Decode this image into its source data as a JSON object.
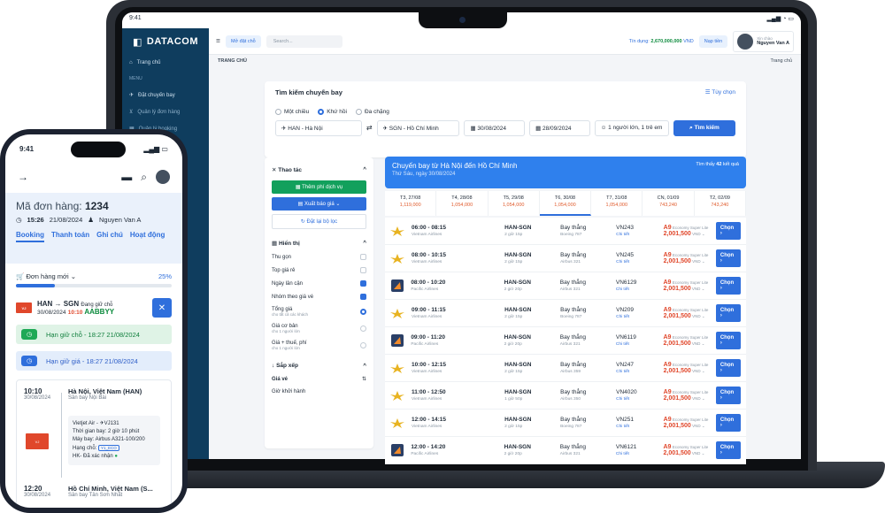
{
  "status_time": "9:41",
  "brand": "DATACOM",
  "sidebar": {
    "home": "Trang chủ",
    "menu": "MENU",
    "items": [
      "Đặt chuyến bay",
      "Quản lý đơn hàng",
      "Quản lý booking"
    ]
  },
  "header": {
    "mode_btn": "Mở đặt chỗ",
    "search_placeholder": "Search...",
    "credit_label": "Tín dụng:",
    "credit_value": "2,670,000,000",
    "credit_unit": "VND",
    "topup": "Nạp tiền",
    "greeting": "Xin chào",
    "user": "Nguyen Van A"
  },
  "breadcrumb": {
    "left": "TRANG CHỦ",
    "right": "Trang chủ"
  },
  "search": {
    "title": "Tìm kiếm chuyến bay",
    "options": "Tùy chọn",
    "trip_types": [
      "Một chiều",
      "Khứ hồi",
      "Đa chặng"
    ],
    "from": "HAN - Hà Nội",
    "to": "SGN - Hồ Chí Minh",
    "depart": "30/08/2024",
    "return": "28/09/2024",
    "pax": "1 người lớn, 1 trẻ em",
    "submit": "Tìm kiếm"
  },
  "filters": {
    "actions_title": "Thao tác",
    "add_service": "Thêm phí dịch vụ",
    "export": "Xuất báo giá",
    "reset": "Đặt lại bộ lọc",
    "display_title": "Hiển thị",
    "checks": [
      {
        "label": "Thu gọn",
        "on": false
      },
      {
        "label": "Top giá rẻ",
        "on": false
      },
      {
        "label": "Ngày lân cận",
        "on": true
      },
      {
        "label": "Nhóm theo giá vé",
        "on": true
      }
    ],
    "price_opts": [
      {
        "label": "Tổng giá",
        "sub": "cho tất cả các khách",
        "on": true
      },
      {
        "label": "Giá cơ bản",
        "sub": "cho 1 người lớn",
        "on": false
      },
      {
        "label": "Giá + thuế, phí",
        "sub": "cho 1 người lớn",
        "on": false
      }
    ],
    "sort_title": "Sắp xếp",
    "sort_items": [
      "Giá vé",
      "Giờ khởi hành"
    ]
  },
  "results": {
    "title": "Chuyến bay từ Hà Nội đến Hồ Chí Minh",
    "subtitle": "Thứ Sáu, ngày 30/08/2024",
    "count_prefix": "Tìm thấy",
    "count": "42",
    "count_suffix": "kết quả"
  },
  "dates": [
    {
      "d": "T3, 27/08",
      "p": "1,119,000"
    },
    {
      "d": "T4, 28/08",
      "p": "1,054,000"
    },
    {
      "d": "T5, 29/08",
      "p": "1,054,000"
    },
    {
      "d": "T6, 30/08",
      "p": "1,054,000"
    },
    {
      "d": "T7, 31/08",
      "p": "1,054,000"
    },
    {
      "d": "CN, 01/09",
      "p": "743,240"
    },
    {
      "d": "T2, 02/09",
      "p": "743,240"
    }
  ],
  "flights": [
    {
      "time": "06:00 - 08:15",
      "airline": "Vietnam Airlines",
      "route": "HAN-SGN",
      "dur": "2 giờ 15p",
      "type": "Bay thẳng",
      "plane": "Boeing 787",
      "code": "VN243",
      "fare": "Economy Super Lite",
      "price": "2,001,500",
      "logo": "va"
    },
    {
      "time": "08:00 - 10:15",
      "airline": "Vietnam Airlines",
      "route": "HAN-SGN",
      "dur": "2 giờ 15p",
      "type": "Bay thẳng",
      "plane": "Airbus 321",
      "code": "VN245",
      "fare": "Economy Super Lite",
      "price": "2,001,500",
      "logo": "va"
    },
    {
      "time": "08:00 - 10:20",
      "airline": "Pacific Airlines",
      "route": "HAN-SGN",
      "dur": "2 giờ 20p",
      "type": "Bay thẳng",
      "plane": "Airbus 321",
      "code": "VN6129",
      "fare": "Economy Super Lite",
      "price": "2,001,500",
      "logo": "pa"
    },
    {
      "time": "09:00 - 11:15",
      "airline": "Vietnam Airlines",
      "route": "HAN-SGN",
      "dur": "2 giờ 15p",
      "type": "Bay thẳng",
      "plane": "Boeing 787",
      "code": "VN209",
      "fare": "Economy Super Lite",
      "price": "2,001,500",
      "logo": "va"
    },
    {
      "time": "09:00 - 11:20",
      "airline": "Pacific Airlines",
      "route": "HAN-SGN",
      "dur": "2 giờ 20p",
      "type": "Bay thẳng",
      "plane": "Airbus 321",
      "code": "VN6119",
      "fare": "Economy Super Lite",
      "price": "2,001,500",
      "logo": "pa"
    },
    {
      "time": "10:00 - 12:15",
      "airline": "Vietnam Airlines",
      "route": "HAN-SGN",
      "dur": "2 giờ 15p",
      "type": "Bay thẳng",
      "plane": "Airbus 359",
      "code": "VN247",
      "fare": "Economy Super Lite",
      "price": "2,001,500",
      "logo": "va"
    },
    {
      "time": "11:00 - 12:50",
      "airline": "Vietnam Airlines",
      "route": "HAN-SGN",
      "dur": "1 giờ 50p",
      "type": "Bay thẳng",
      "plane": "Airbus 350",
      "code": "VN4020",
      "fare": "Economy Super Lite",
      "price": "2,001,500",
      "logo": "va"
    },
    {
      "time": "12:00 - 14:15",
      "airline": "Vietnam Airlines",
      "route": "HAN-SGN",
      "dur": "2 giờ 15p",
      "type": "Bay thẳng",
      "plane": "Boeing 787",
      "code": "VN251",
      "fare": "Economy Super Lite",
      "price": "2,001,500",
      "logo": "va"
    },
    {
      "time": "12:00 - 14:20",
      "airline": "Pacific Airlines",
      "route": "HAN-SGN",
      "dur": "2 giờ 20p",
      "type": "Bay thẳng",
      "plane": "Airbus 321",
      "code": "VN6121",
      "fare": "Economy Super Lite",
      "price": "2,001,500",
      "logo": "pa"
    }
  ],
  "row_labels": {
    "details": "Chi tiết",
    "currency": "VND",
    "choose": "Chọn",
    "fare_class": "A9"
  },
  "phone": {
    "order_label": "Mã đơn hàng:",
    "order_no": "1234",
    "time": "15:26",
    "date": "21/08/2024",
    "agent": "Nguyen Van A",
    "tabs": [
      "Booking",
      "Thanh toán",
      "Ghi chú",
      "Hoạt động"
    ],
    "status": "Đơn hàng mới",
    "progress": "25%",
    "route": "HAN → SGN",
    "hold_state": "Đang giữ chỗ",
    "seg_date": "30/08/2024",
    "seg_time": "10:10",
    "pnr": "AABBYY",
    "hold1": "Hạn giữ chỗ - 18:27 21/08/2024",
    "hold2": "Hạn giữ giá - 18:27 21/08/2024",
    "dep_time": "10:10",
    "dep_date": "30/08/2024",
    "dep_city": "Hà Nội, Việt Nam (HAN)",
    "dep_port": "Sân bay Nội Bài",
    "flight": "Vietjet Air - ✈VJ131",
    "duration": "Thời gian bay: 2 giờ 10 phút",
    "aircraft": "Máy bay: Airbus A321-100/200",
    "class_label": "Hạng chỗ:",
    "class_code": "Y1_ECO",
    "confirm": "HK- Đã xác nhận",
    "arr_time": "12:20",
    "arr_date": "30/08/2024",
    "arr_city": "Hồ Chí Minh, Việt Nam (S...",
    "arr_port": "Sân bay Tân Sơn Nhất"
  }
}
